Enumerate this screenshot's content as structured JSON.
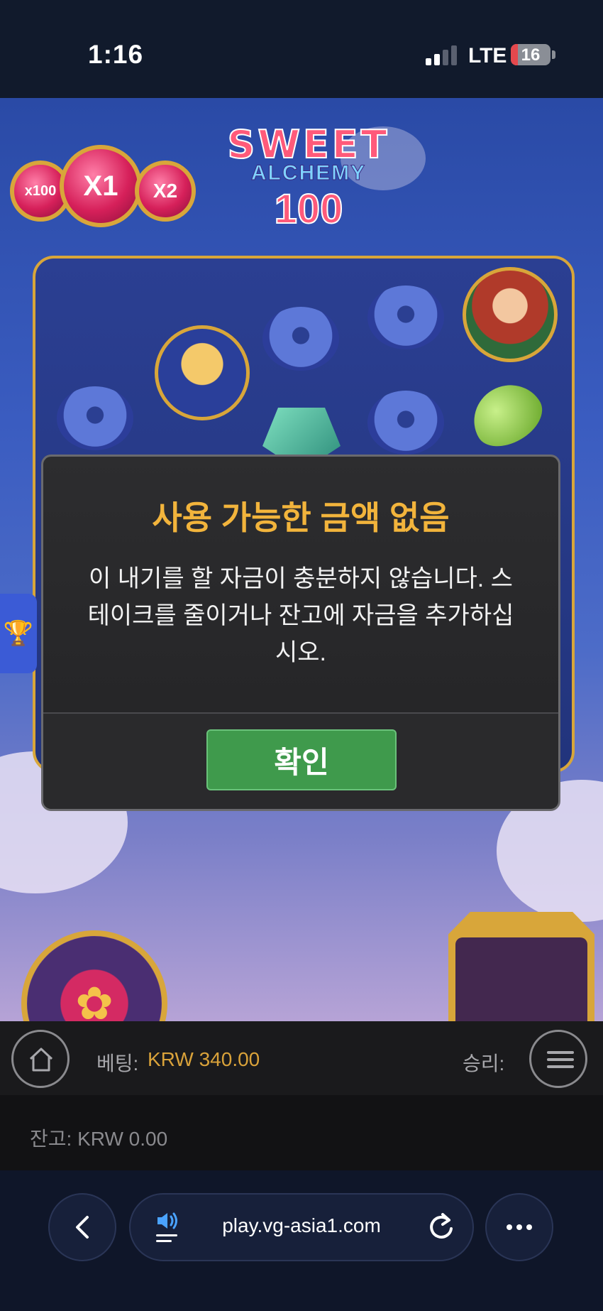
{
  "status_bar": {
    "time": "1:16",
    "network": "LTE",
    "battery": "16"
  },
  "game": {
    "title_line1": "SWEET",
    "title_line2": "ALCHEMY",
    "title_line3": "100",
    "multipliers": [
      "x100",
      "X1",
      "X2"
    ]
  },
  "modal": {
    "title": "사용 가능한 금액 없음",
    "message": "이 내기를 할 자금이 충분하지 않습니다. 스테이크를 줄이거나 잔고에 자금을 추가하십시오.",
    "ok_label": "확인"
  },
  "controls": {
    "bet_label": "베팅:",
    "bet_value": "KRW 340.00",
    "win_label": "승리:",
    "balance_label": "잔고: KRW 0.00"
  },
  "browser": {
    "url": "play.vg-asia1.com"
  },
  "icons": {
    "left_tab": "trophy-icon",
    "home": "home-icon",
    "menu": "menu-icon",
    "back": "chevron-left-icon",
    "reload": "reload-icon",
    "more": "more-icon"
  },
  "colors": {
    "modal_title": "#f2b43c",
    "ok_button": "#3f9a4c",
    "bet_value": "#d9a23a"
  }
}
